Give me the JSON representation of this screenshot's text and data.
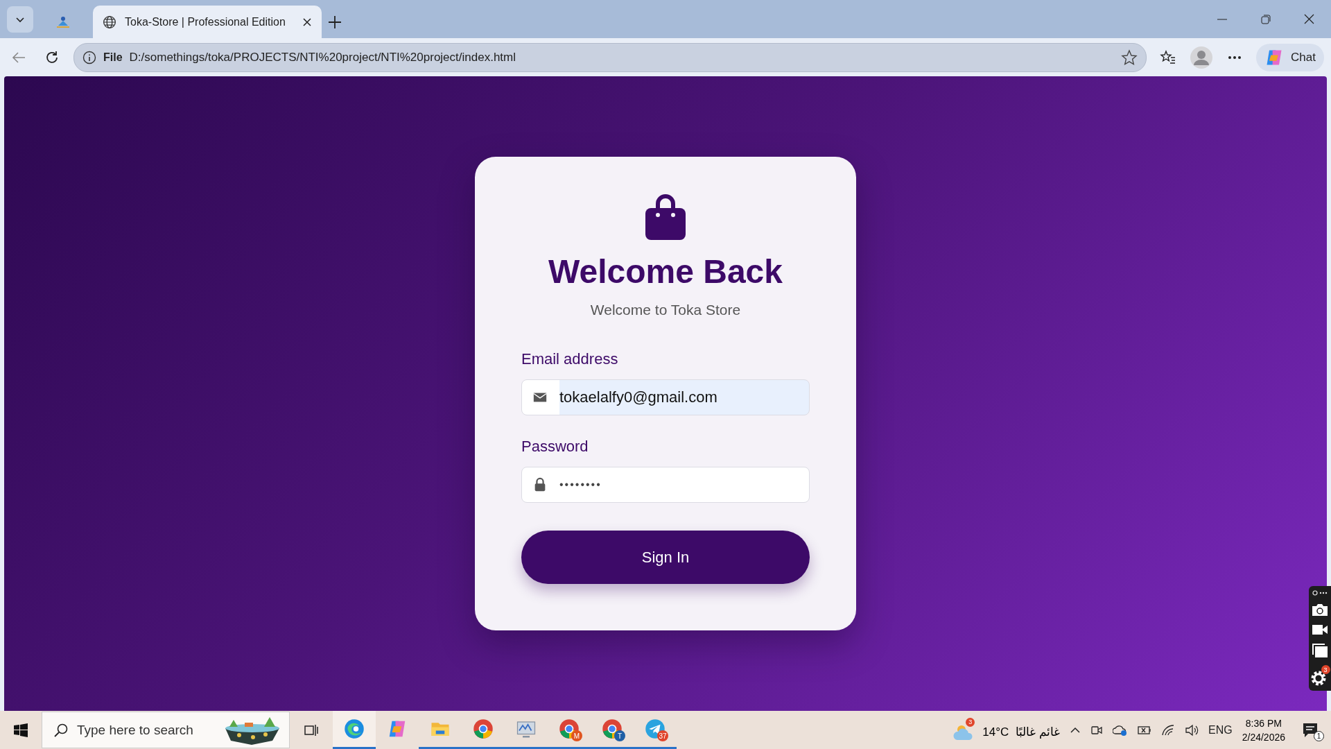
{
  "browser": {
    "tabs": [
      {
        "kind": "pinned",
        "selected": false
      },
      {
        "kind": "page",
        "title": "Toka-Store | Professional Edition",
        "selected": true
      }
    ],
    "address": {
      "scheme": "File",
      "url": "D:/somethings/toka/PROJECTS/NTI%20project/NTI%20project/index.html"
    },
    "chat_label": "Chat"
  },
  "login": {
    "title": "Welcome Back",
    "subtitle": "Welcome to Toka Store",
    "fields": [
      {
        "kind": "email",
        "label": "Email address",
        "value": "tokaelalfy0@gmail.com",
        "autofilled": true
      },
      {
        "kind": "password",
        "label": "Password",
        "value": "••••••••",
        "autofilled": false
      }
    ],
    "button": "Sign In"
  },
  "capture_toolbar": {
    "settings_badge": "3"
  },
  "taskbar": {
    "search_placeholder": "Type here to search",
    "apps": [
      {
        "kind": "edge",
        "running": true,
        "active": true
      },
      {
        "kind": "copilot",
        "running": false,
        "active": false
      },
      {
        "kind": "explorer",
        "running": true,
        "active": false
      },
      {
        "kind": "chrome",
        "running": true,
        "active": false
      },
      {
        "kind": "monitor",
        "running": true,
        "active": false
      },
      {
        "kind": "chrome",
        "badge": "M",
        "running": true,
        "active": false
      },
      {
        "kind": "chrome",
        "badge": "T",
        "running": true,
        "active": false
      },
      {
        "kind": "telegram",
        "badge": "37",
        "running": true,
        "active": false
      }
    ],
    "weather": {
      "badge": "3",
      "temperature": "14°C",
      "condition": "غائم غالبًا"
    },
    "language": "ENG",
    "time": "8:36 PM",
    "date": "2/24/2026",
    "notifications": "1"
  }
}
